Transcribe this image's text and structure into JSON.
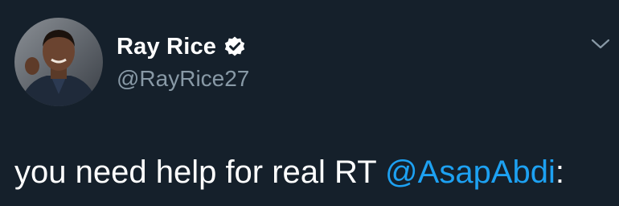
{
  "user": {
    "display_name": "Ray Rice",
    "handle": "@RayRice27",
    "verified": true
  },
  "tweet": {
    "text_before": "you need help for real RT ",
    "mention": "@AsapAbdi",
    "text_after": ":"
  },
  "icons": {
    "verified": "verified-badge-icon",
    "menu": "chevron-down-icon"
  },
  "colors": {
    "background": "#15202b",
    "text": "#ffffff",
    "secondary_text": "#8899a6",
    "link": "#1da1f2"
  }
}
